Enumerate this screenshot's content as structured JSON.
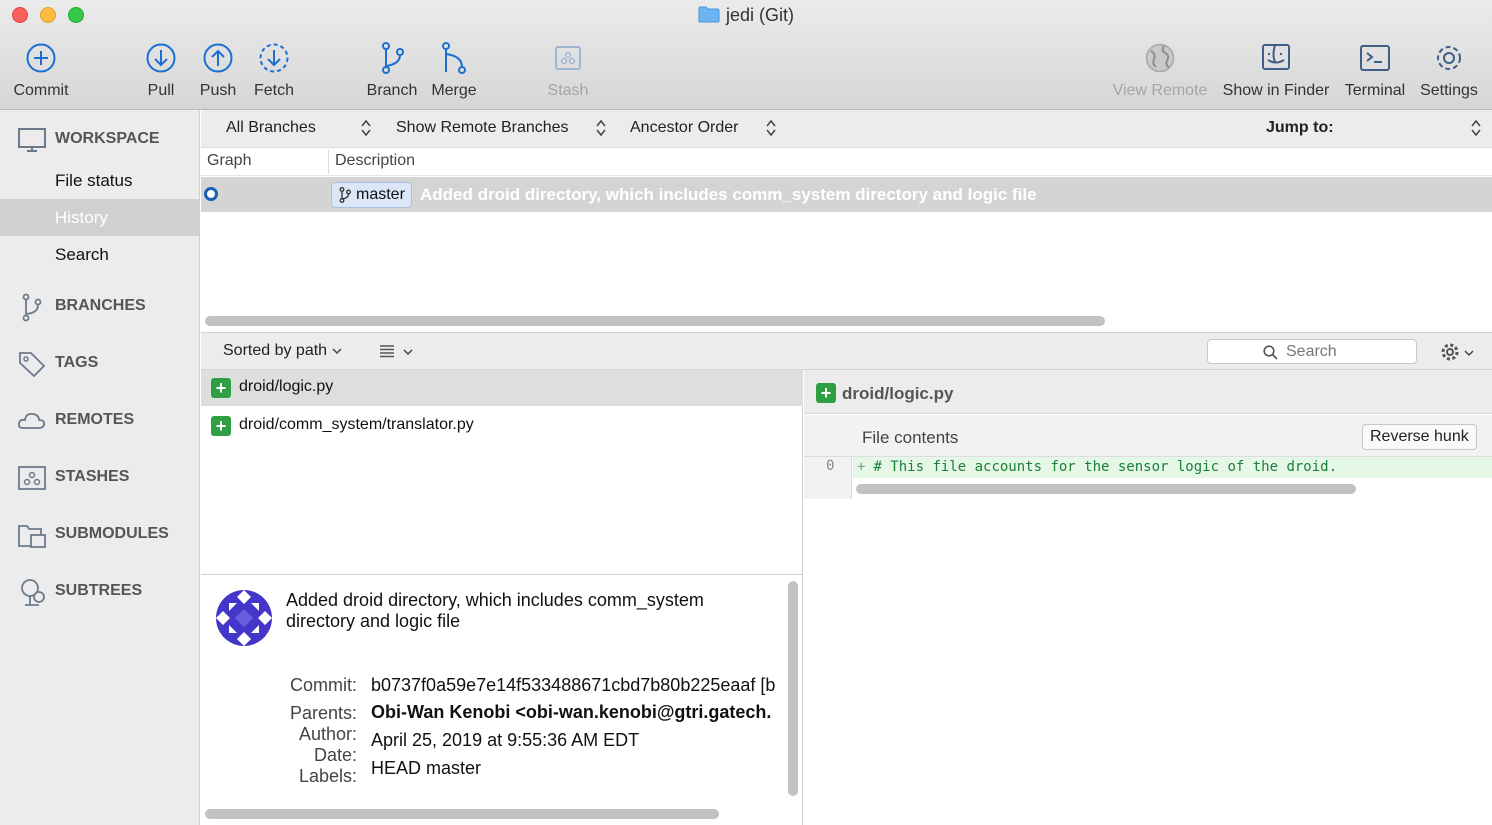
{
  "window": {
    "title": "jedi (Git)"
  },
  "toolbar": {
    "commit": "Commit",
    "pull": "Pull",
    "push": "Push",
    "fetch": "Fetch",
    "branch": "Branch",
    "merge": "Merge",
    "stash": "Stash",
    "view_remote": "View Remote",
    "show_in_finder": "Show in Finder",
    "terminal": "Terminal",
    "settings": "Settings"
  },
  "sidebar": {
    "workspace": "WORKSPACE",
    "workspace_items": [
      "File status",
      "History",
      "Search"
    ],
    "selected_item": "History",
    "branches": "BRANCHES",
    "tags": "TAGS",
    "remotes": "REMOTES",
    "stashes": "STASHES",
    "submodules": "SUBMODULES",
    "subtrees": "SUBTREES"
  },
  "filters": {
    "branches": "All Branches",
    "remote": "Show Remote Branches",
    "order": "Ancestor Order",
    "jump_to": "Jump to:"
  },
  "commit_list": {
    "columns": [
      "Graph",
      "Description"
    ],
    "rows": [
      {
        "branch": "master",
        "message": "Added droid directory, which includes comm_system directory and logic file"
      }
    ]
  },
  "files_bar": {
    "sort": "Sorted by path",
    "search_placeholder": "Search"
  },
  "files": [
    "droid/logic.py",
    "droid/comm_system/translator.py"
  ],
  "commit_details": {
    "message": "Added droid directory, which includes comm_system directory and logic file",
    "labels": [
      "Commit:",
      "Parents:",
      "Author:",
      "Date:",
      "Labels:"
    ],
    "commit": "b0737f0a59e7e14f533488671cbd7b80b225eaaf [b",
    "author": "Obi-Wan Kenobi <obi-wan.kenobi@gtri.gatech.",
    "date": "April 25, 2019 at 9:55:36 AM EDT",
    "labels_value": "HEAD master"
  },
  "diff": {
    "file": "droid/logic.py",
    "hunk_title": "File contents",
    "reverse_hunk": "Reverse hunk",
    "line_number": "0",
    "line": "# This file accounts for the sensor logic of the droid."
  },
  "colors": {
    "accent": "#1a5fb4",
    "added": "#2ea043",
    "added_bg": "#e5f7e7"
  }
}
